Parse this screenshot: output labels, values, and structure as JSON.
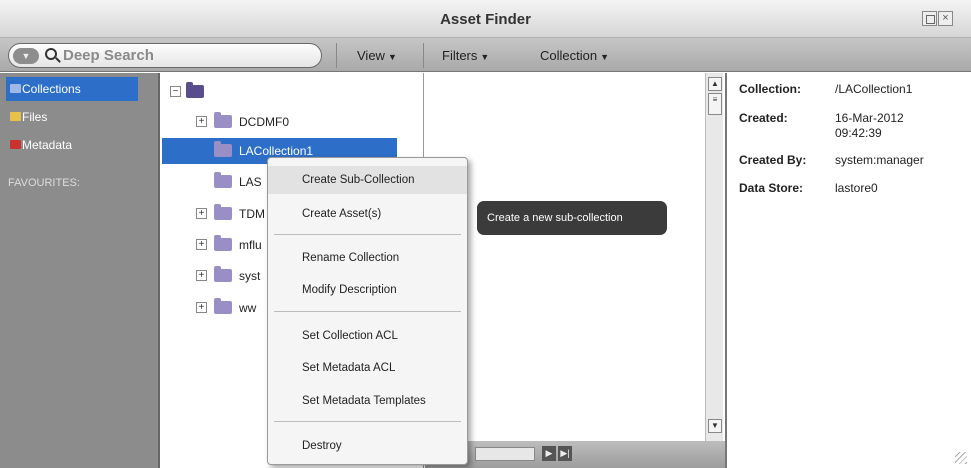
{
  "window": {
    "title": "Asset Finder"
  },
  "toolbar": {
    "search_placeholder": "Deep Search",
    "menus": [
      {
        "label": "View"
      },
      {
        "label": "Filters"
      },
      {
        "label": "Collection"
      }
    ]
  },
  "sidebar": {
    "items": [
      {
        "label": "Collections",
        "selected": true,
        "icon": "folder-icon"
      },
      {
        "label": "Files",
        "selected": false,
        "icon": "folder-icon"
      },
      {
        "label": "Metadata",
        "selected": false,
        "icon": "metadata-icon"
      }
    ],
    "section_label": "FAVOURITES:"
  },
  "tree": {
    "nodes": [
      {
        "label": "DCDMF0",
        "expander": "+"
      },
      {
        "label": "LACollection1",
        "selected": true
      },
      {
        "label": "LAS"
      },
      {
        "label": "TDM",
        "expander": "+"
      },
      {
        "label": "mflu",
        "expander": "+"
      },
      {
        "label": "syst",
        "expander": "+"
      },
      {
        "label": "ww",
        "expander": "+"
      }
    ],
    "root_expander": "−"
  },
  "context_menu": {
    "items": [
      "Create Sub-Collection",
      "Create Asset(s)",
      "Rename Collection",
      "Modify Description",
      "Set Collection ACL",
      "Set Metadata ACL",
      "Set Metadata Templates",
      "Destroy"
    ],
    "hovered": "Create Sub-Collection"
  },
  "tooltip": {
    "text": "Create a new sub-collection"
  },
  "details": {
    "collection_label": "Collection:",
    "collection_value": "/LACollection1",
    "created_label": "Created:",
    "created_date": "16-Mar-2012",
    "created_time": "09:42:39",
    "created_by_label": "Created By:",
    "created_by_value": "system:manager",
    "data_store_label": "Data Store:",
    "data_store_value": "lastore0"
  },
  "colors": {
    "selection": "#2d6fc8",
    "folder": "#5a4d8c",
    "tooltip_bg": "#3b3b3b"
  }
}
